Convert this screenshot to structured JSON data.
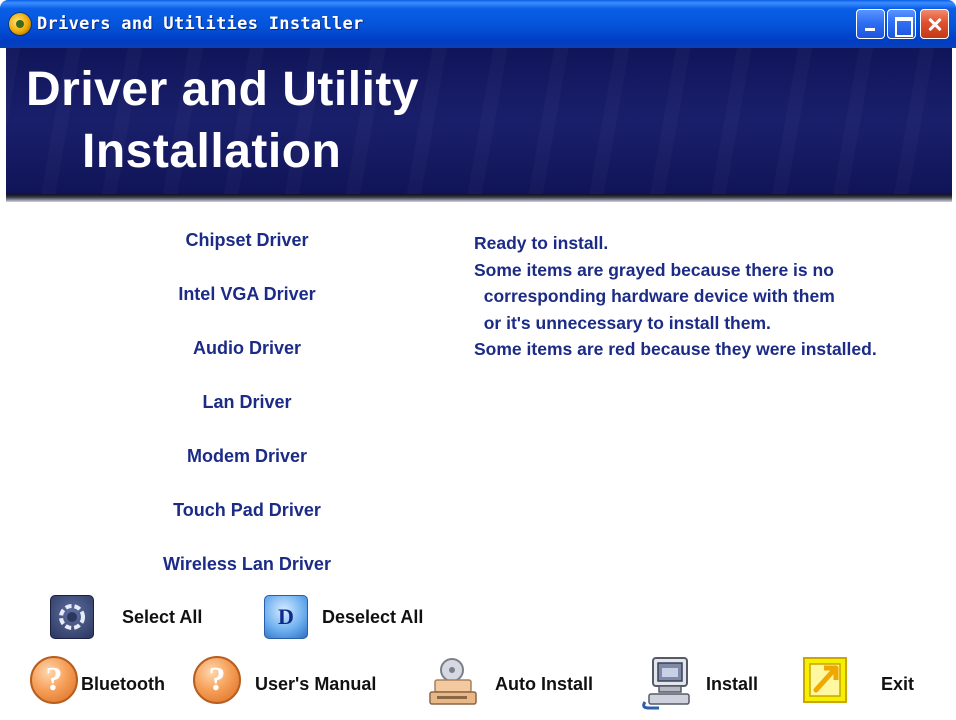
{
  "window": {
    "title": "Drivers and Utilities Installer"
  },
  "banner": {
    "line1": "Driver and Utility",
    "line2": "Installation"
  },
  "drivers": [
    {
      "label": "Chipset Driver"
    },
    {
      "label": "Intel VGA Driver"
    },
    {
      "label": "Audio Driver"
    },
    {
      "label": "Lan Driver"
    },
    {
      "label": "Modem Driver"
    },
    {
      "label": "Touch Pad Driver"
    },
    {
      "label": "Wireless Lan Driver"
    }
  ],
  "status": {
    "lines": [
      "Ready to install.",
      "Some items are grayed because there is no",
      "  corresponding hardware device with them",
      "  or it's unnecessary to install them.",
      "Some items are red because they were installed."
    ]
  },
  "selection": {
    "select_all": "Select All",
    "deselect_all": "Deselect All",
    "deselect_icon_letter": "D"
  },
  "toolbar": {
    "bluetooth": "Bluetooth",
    "users_manual": "User's Manual",
    "auto_install": "Auto Install",
    "install": "Install",
    "exit": "Exit",
    "help_glyph": "?"
  },
  "colors": {
    "title_bar": "#0453d9",
    "banner": "#1a1f6b",
    "driver_text": "#1b2b86",
    "close_button": "#e1502e"
  }
}
